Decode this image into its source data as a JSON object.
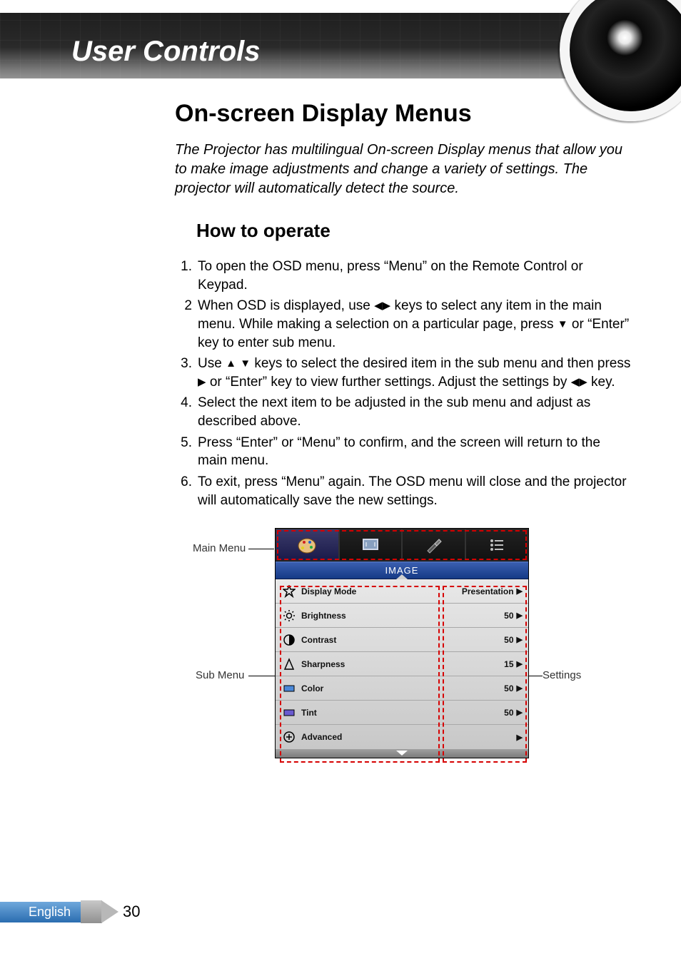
{
  "header": {
    "title": "User Controls"
  },
  "section": {
    "h1": "On-screen Display Menus",
    "intro": "The Projector has multilingual On-screen Display menus that allow you to make image adjustments and change a variety of settings. The projector will automatically detect the source.",
    "h2": "How to operate"
  },
  "steps": [
    {
      "num": "1.",
      "pre": "To open the OSD menu, press “Menu” on the Remote Control or Keypad.",
      "mid": "",
      "post": ""
    },
    {
      "num": "2",
      "pre": "When OSD is displayed, use ",
      "mid": " keys to select any item in the main menu. While making a selection on a particular page, press ",
      "post": " or “Enter” key to enter sub menu.",
      "icons1": "lr",
      "icons2": "d"
    },
    {
      "num": "3.",
      "pre": "Use ",
      "mid": " keys to select the desired item in the sub menu and then press ",
      "post": " or “Enter” key to view further settings. Adjust the settings by ",
      "tail": " key.",
      "icons1": "ud",
      "icons2": "r",
      "icons3": "lr"
    },
    {
      "num": "4.",
      "pre": "Select the next item to be adjusted in the sub menu and adjust as described above.",
      "mid": "",
      "post": ""
    },
    {
      "num": "5.",
      "pre": "Press “Enter” or “Menu” to confirm, and the screen will return to the main menu.",
      "mid": "",
      "post": ""
    },
    {
      "num": "6.",
      "pre": "To exit, press “Menu” again. The OSD menu will close and the projector will automatically save the new settings.",
      "mid": "",
      "post": ""
    }
  ],
  "osd": {
    "main_menu_label": "Main Menu",
    "sub_menu_label": "Sub Menu",
    "settings_label": "Settings",
    "title": "IMAGE",
    "tabs": [
      "image",
      "display",
      "setup",
      "options"
    ],
    "rows": [
      {
        "icon": "star",
        "label": "Display Mode",
        "value": "Presentation"
      },
      {
        "icon": "sun",
        "label": "Brightness",
        "value": "50"
      },
      {
        "icon": "contrast",
        "label": "Contrast",
        "value": "50"
      },
      {
        "icon": "sharp",
        "label": "Sharpness",
        "value": "15"
      },
      {
        "icon": "color",
        "label": "Color",
        "value": "50"
      },
      {
        "icon": "tint",
        "label": "Tint",
        "value": "50"
      },
      {
        "icon": "plus",
        "label": "Advanced",
        "value": ""
      }
    ]
  },
  "footer": {
    "language": "English",
    "page": "30"
  }
}
